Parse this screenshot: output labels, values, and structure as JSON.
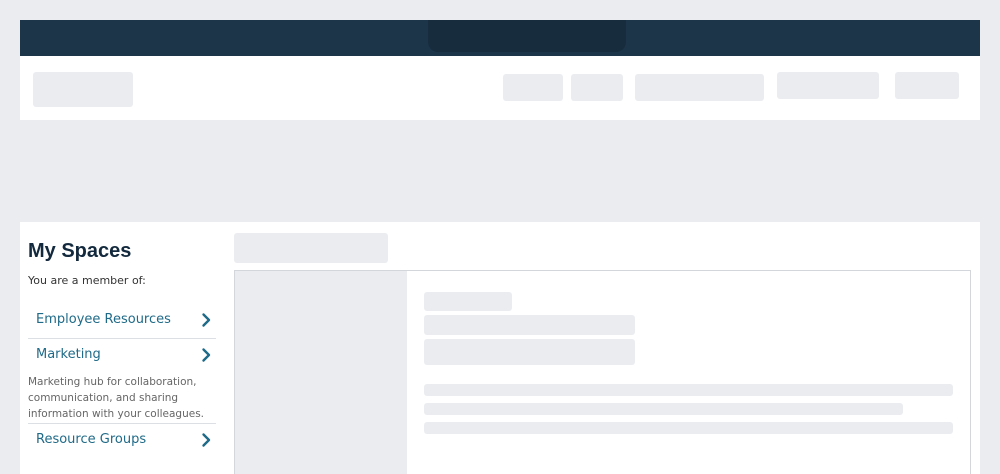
{
  "sidebar": {
    "title": "My Spaces",
    "subtitle": "You are a member of:",
    "items": [
      {
        "label": "Employee Resources",
        "icon": "chevron-right-icon"
      },
      {
        "label": "Marketing",
        "icon": "chevron-right-icon",
        "description": "Marketing hub for collaboration, communication, and sharing information with your colleagues."
      },
      {
        "label": "Resource Groups",
        "icon": "chevron-right-icon"
      }
    ]
  },
  "colors": {
    "topbar": "#1c3548",
    "link": "#1f6a88",
    "title": "#13293d",
    "placeholder": "#ebecf0",
    "background": "#ebecf0"
  }
}
